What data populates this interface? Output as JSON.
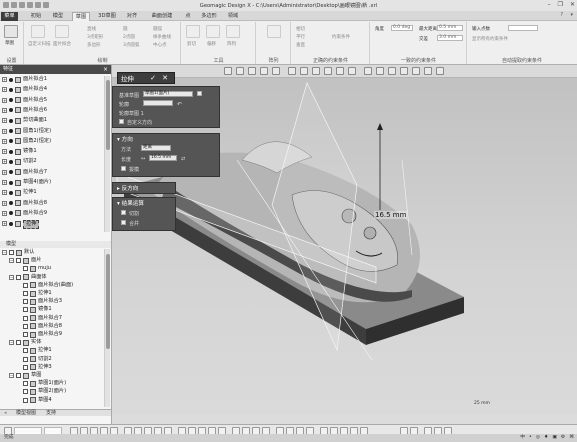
{
  "window": {
    "title": "Geomagic Design X - C:\\Users\\Administrator\\Desktop\\画眼镜图\\新 .xrl",
    "controls": [
      "–",
      "❐",
      "✕"
    ]
  },
  "ribbon_tabs": [
    "菜单",
    "初始",
    "模型",
    "草图",
    "3D草图",
    "对齐",
    "曲面创建",
    "点",
    "多边形",
    "领域"
  ],
  "ribbon": {
    "groups": {
      "settings": {
        "label": "设置",
        "big": "草图"
      },
      "sketch": {
        "label": "绘制",
        "items": [
          "直线",
          "矩形",
          "圆",
          "圆弧",
          "样条曲线",
          "自定义扫描",
          "面片拟合",
          "3点矩形",
          "2点圆",
          "3点圆弧",
          "多边形",
          "中心点"
        ]
      },
      "tools": {
        "label": "工具",
        "items": [
          "剪切",
          "偏移",
          "阵列"
        ]
      },
      "array": {
        "label": "阵列"
      },
      "orient": {
        "label": "正确的约束条件",
        "items": [
          "相切",
          "平行",
          "垂直",
          "约束条件"
        ]
      },
      "constraint": {
        "label": "一致的约束条件",
        "items": [
          "角度",
          "最长距离",
          "全部",
          "交点"
        ]
      },
      "extract": {
        "label": "自动提取约束条件",
        "items": [
          "输入点数",
          "显示所有约束条件"
        ]
      }
    },
    "fields": {
      "angle_label": "角度",
      "angle_value": "0.0 deg",
      "maxdist_label": "最大距离",
      "maxdist_value": "0.5 mm",
      "nodes_label": "交差",
      "nodes_value": "3.0 mm",
      "input_label": "输入点数"
    }
  },
  "left_panel": {
    "title": "特征",
    "feature_tree": [
      "面片拟合1",
      "面片拟合4",
      "面片拟合5",
      "面片拟合6",
      "剪切曲面1",
      "圆角1(恒定)",
      "圆角2(恒定)",
      "镜像1",
      "切割2",
      "面片拟合7",
      "草图4(面片)",
      "拉伸1",
      "面片拟合8",
      "面片拟合9",
      "拉伸"
    ],
    "model_header": "模型",
    "model_items": [
      {
        "label": "默认",
        "level": 0
      },
      {
        "label": "面片",
        "level": 1
      },
      {
        "label": "muju",
        "level": 2
      },
      {
        "label": "曲面体",
        "level": 1
      },
      {
        "label": "面片拟合(曲面)",
        "level": 2
      },
      {
        "label": "拉伸1",
        "level": 2
      },
      {
        "label": "面片拟合3",
        "level": 2
      },
      {
        "label": "镜像1",
        "level": 2
      },
      {
        "label": "面片拟合7",
        "level": 2
      },
      {
        "label": "面片拟合8",
        "level": 2
      },
      {
        "label": "面片拟合9",
        "level": 2
      },
      {
        "label": "实体",
        "level": 1
      },
      {
        "label": "拉伸1",
        "level": 2
      },
      {
        "label": "切割2",
        "level": 2
      },
      {
        "label": "拉伸3",
        "level": 2
      },
      {
        "label": "草图",
        "level": 1
      },
      {
        "label": "草图1(面片)",
        "level": 2
      },
      {
        "label": "草图2(面片)",
        "level": 2
      },
      {
        "label": "草图4",
        "level": 2
      }
    ],
    "bottom_tabs": [
      "模型视图",
      "支持"
    ]
  },
  "dialog": {
    "title": "拉伸",
    "ok": "✓",
    "cancel": "✕",
    "base_label": "基准草图",
    "base_value": "草图1(面片)",
    "contour_label": "轮廓",
    "contour_item": "轮廓草图 1",
    "custom_dir": "自定义方向",
    "direction_header": "方向",
    "method_label": "方法",
    "method_value": "距离",
    "length_label": "长度",
    "length_value": "16.5 mm",
    "taper_label": "拔模",
    "reverse_header": "反方向",
    "result_header": "结果运算",
    "cut_label": "切割",
    "merge_label": "合并"
  },
  "viewport": {
    "dimension": "16.5 mm",
    "scale_text": "25 mm"
  },
  "status": {
    "left": "完成",
    "view": "视角",
    "mode": "曲面",
    "tray": [
      "中",
      "•",
      "◎",
      "♦",
      "▣",
      "⚙",
      "⌘"
    ]
  }
}
